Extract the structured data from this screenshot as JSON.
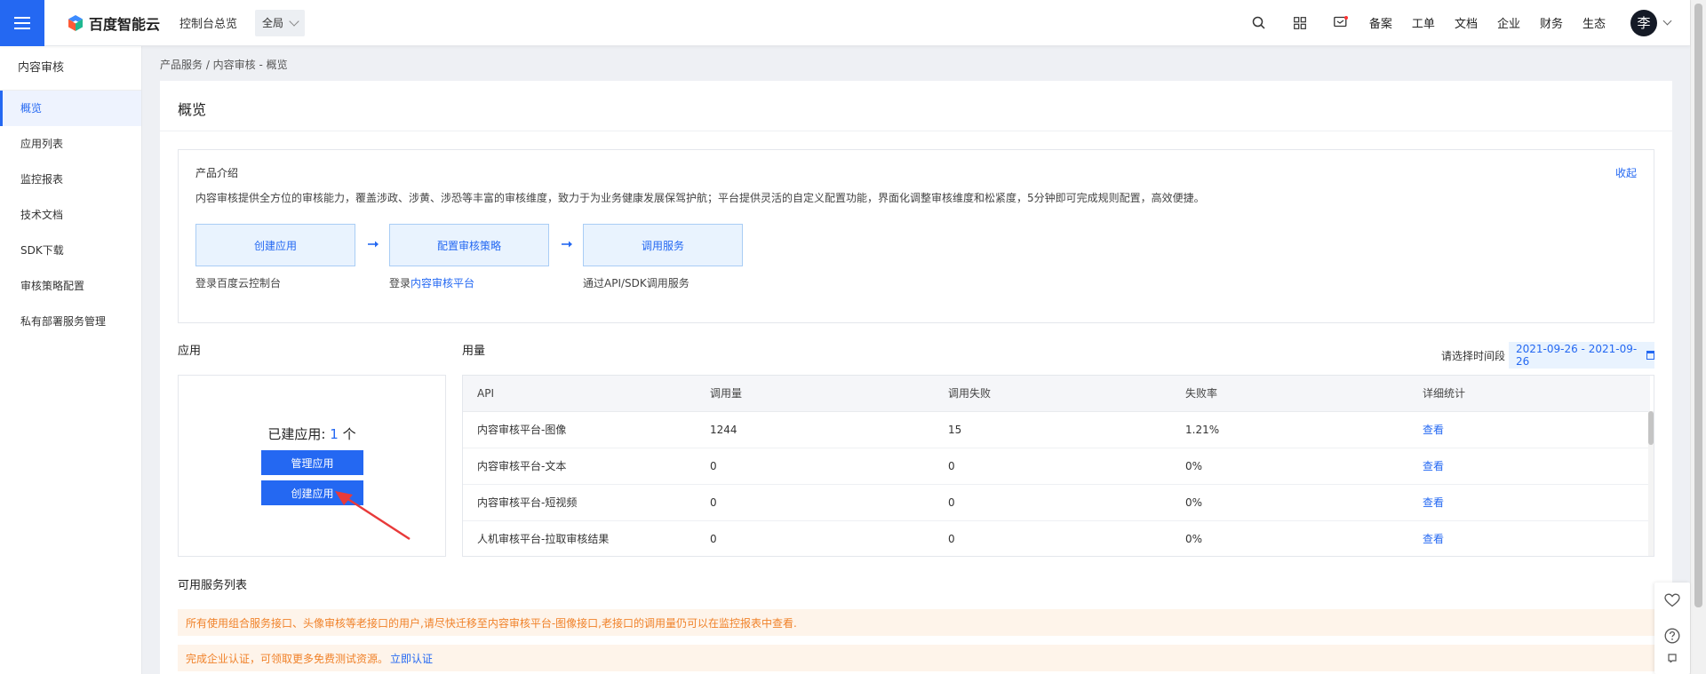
{
  "topbar": {
    "logo_text": "百度智能云",
    "console_link": "控制台总览",
    "region": "全局",
    "links": [
      "备案",
      "工单",
      "文档",
      "企业",
      "财务",
      "生态"
    ],
    "avatar_char": "李"
  },
  "sidebar": {
    "title": "内容审核",
    "items": [
      {
        "label": "概览"
      },
      {
        "label": "应用列表"
      },
      {
        "label": "监控报表"
      },
      {
        "label": "技术文档"
      },
      {
        "label": "SDK下载"
      },
      {
        "label": "审核策略配置"
      },
      {
        "label": "私有部署服务管理"
      }
    ]
  },
  "breadcrumb": "产品服务 / 内容审核 - 概览",
  "page_title": "概览",
  "intro": {
    "title": "产品介绍",
    "collapse": "收起",
    "description": "内容审核提供全方位的审核能力，覆盖涉政、涉黄、涉恐等丰富的审核维度，致力于为业务健康发展保驾护航；平台提供灵活的自定义配置功能，界面化调整审核维度和松紧度，5分钟即可完成规则配置，高效便捷。",
    "steps": [
      {
        "label": "创建应用",
        "sub": "登录百度云控制台"
      },
      {
        "label": "配置审核策略",
        "sub_prefix": "登录",
        "sub_link": "内容审核平台"
      },
      {
        "label": "调用服务",
        "sub": "通过API/SDK调用服务"
      }
    ]
  },
  "apps": {
    "section_title": "应用",
    "count_prefix": "已建应用: ",
    "count": "1",
    "count_suffix": " 个",
    "manage_button": "管理应用",
    "create_button": "创建应用"
  },
  "usage": {
    "section_title": "用量",
    "date_label": "请选择时间段",
    "date_range": "2021-09-26 - 2021-09-26",
    "columns": [
      "API",
      "调用量",
      "调用失败",
      "失败率",
      "详细统计"
    ],
    "rows": [
      [
        "内容审核平台-图像",
        "1244",
        "15",
        "1.21%",
        "查看"
      ],
      [
        "内容审核平台-文本",
        "0",
        "0",
        "0%",
        "查看"
      ],
      [
        "内容审核平台-短视频",
        "0",
        "0",
        "0%",
        "查看"
      ],
      [
        "人机审核平台-拉取审核结果",
        "0",
        "0",
        "0%",
        "查看"
      ]
    ]
  },
  "services": {
    "section_title": "可用服务列表",
    "notice1": "所有使用组合服务接口、头像审核等老接口的用户,请尽快迁移至内容审核平台-图像接口,老接口的调用量仍可以在监控报表中查看.",
    "notice2_text": "完成企业认证，可领取更多免费测试资源。",
    "notice2_link": "立即认证"
  },
  "colors": {
    "primary": "#2468f2",
    "warning_text": "#f0822a",
    "warning_bg": "#fef4ea",
    "annotation_red": "#e83a3a"
  }
}
